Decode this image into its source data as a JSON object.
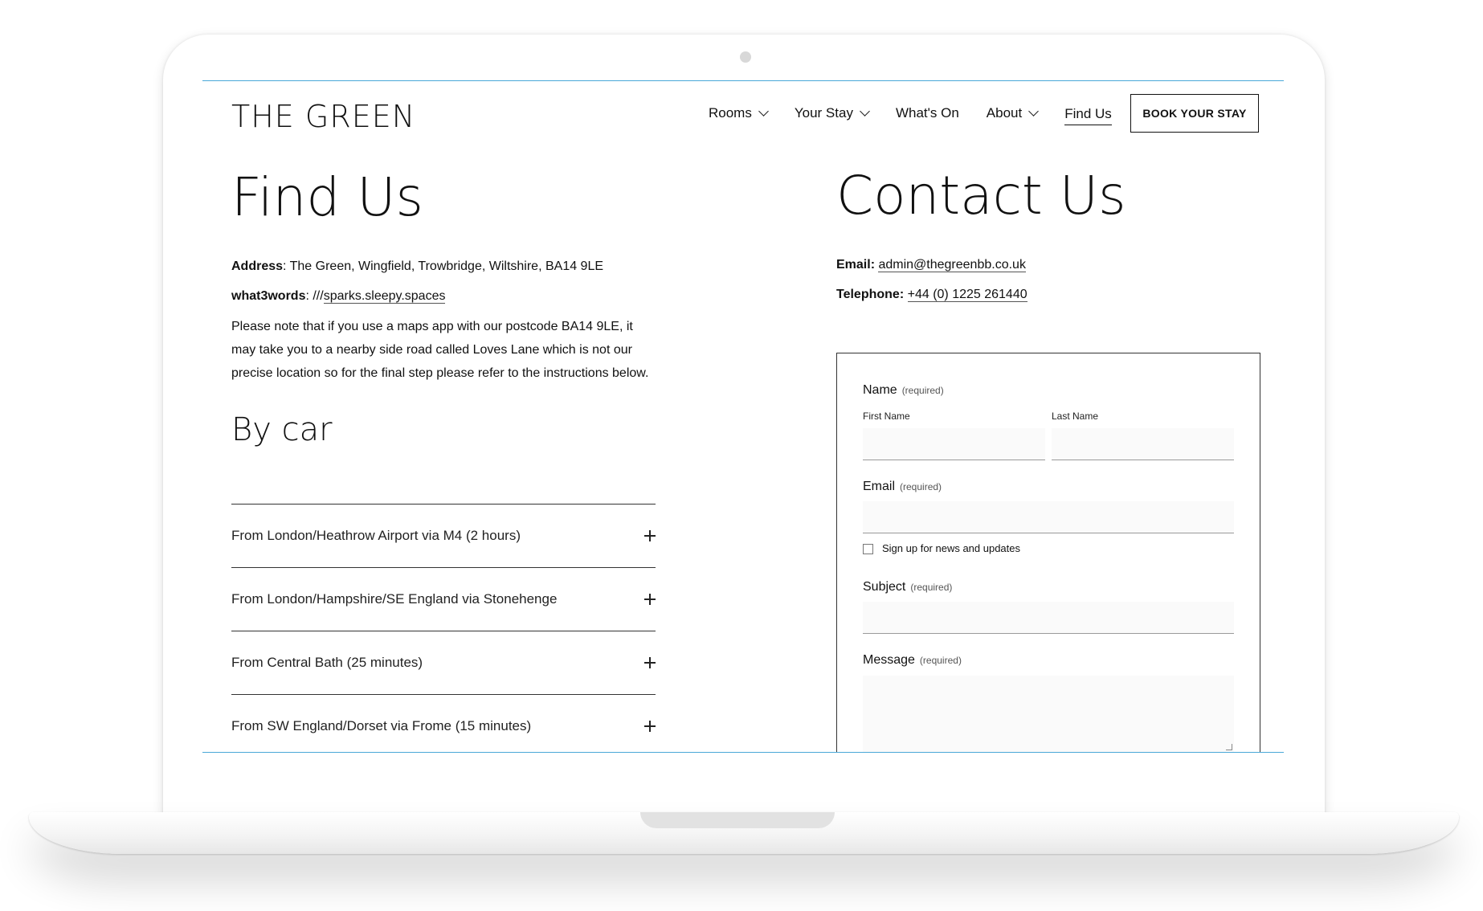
{
  "header": {
    "logo": "THE GREEN",
    "nav": [
      {
        "label": "Rooms",
        "has_dropdown": true
      },
      {
        "label": "Your Stay",
        "has_dropdown": true
      },
      {
        "label": "What's On",
        "has_dropdown": false
      },
      {
        "label": "About",
        "has_dropdown": true
      },
      {
        "label": "Find Us",
        "has_dropdown": false,
        "active": true
      }
    ],
    "cta": "BOOK YOUR STAY"
  },
  "find_us": {
    "title": "Find Us",
    "address_label": "Address",
    "address_value": ": The Green, Wingfield, Trowbridge, Wiltshire, BA14 9LE",
    "w3w_label": "what3words",
    "w3w_prefix": ": ///",
    "w3w_link": "sparks.sleepy.spaces",
    "note": "Please note that if you use a maps app with our postcode BA14 9LE, it may take you to a nearby side road called Loves Lane which is not our precise location so for the final step please refer to the instructions below.",
    "by_car_title": "By car",
    "routes": [
      "From London/Heathrow Airport via M4 (2 hours)",
      "From London/Hampshire/SE England via Stonehenge",
      "From Central Bath (25 minutes)",
      "From SW England/Dorset via Frome (15 minutes)"
    ]
  },
  "contact_us": {
    "title": "Contact Us",
    "email_label": "Email:",
    "email_value": "admin@thegreenbb.co.uk",
    "phone_label": "Telephone:",
    "phone_value": "+44 (0) 1225 261440"
  },
  "form": {
    "name_label": "Name",
    "required": "(required)",
    "first_name_label": "First Name",
    "last_name_label": "Last Name",
    "email_label": "Email",
    "newsletter_label": "Sign up for news and updates",
    "subject_label": "Subject",
    "message_label": "Message"
  },
  "colors": {
    "accent_line": "#4aa8d8",
    "text": "#111111"
  }
}
